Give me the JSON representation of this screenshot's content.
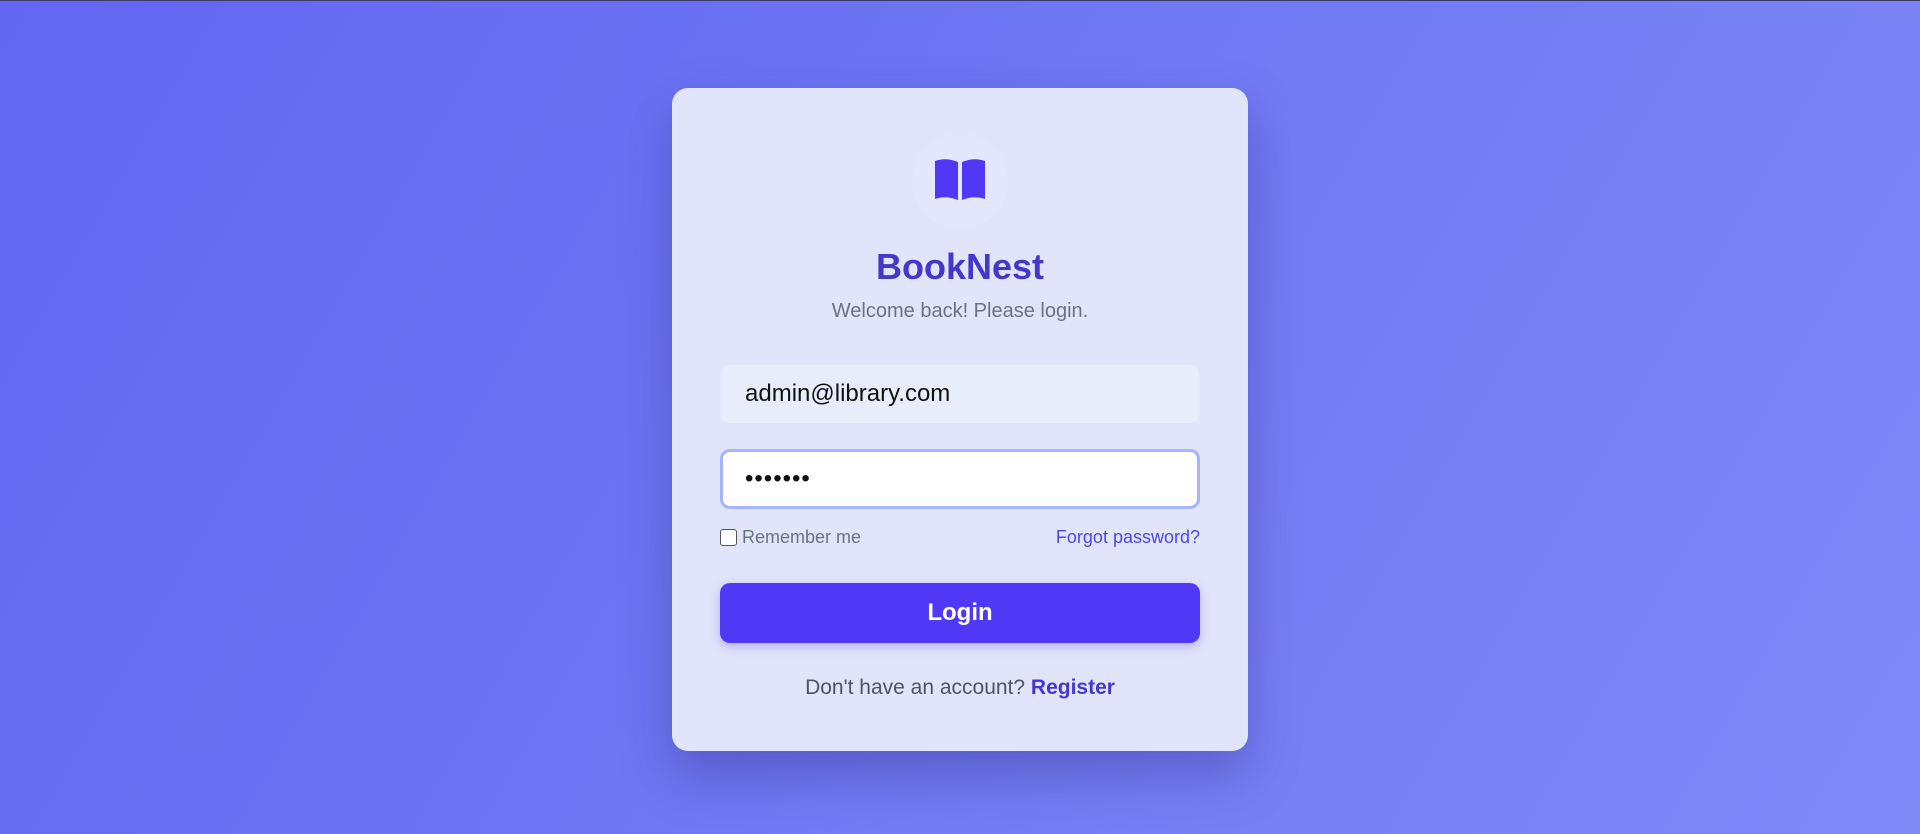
{
  "app": {
    "name": "BookNest",
    "subtitle": "Welcome back! Please login.",
    "logo_icon": "open-book-icon"
  },
  "form": {
    "email_value": "admin@library.com",
    "password_masked": "•••••••",
    "remember_label": "Remember me",
    "remember_checked": false,
    "forgot_label": "Forgot password?",
    "login_label": "Login"
  },
  "footer": {
    "prompt": "Don't have an account?",
    "register_label": "Register"
  },
  "colors": {
    "accent": "#4f39f6",
    "brand_text": "#4338ca",
    "background_start": "#6366f1",
    "background_end": "#8189f7"
  }
}
